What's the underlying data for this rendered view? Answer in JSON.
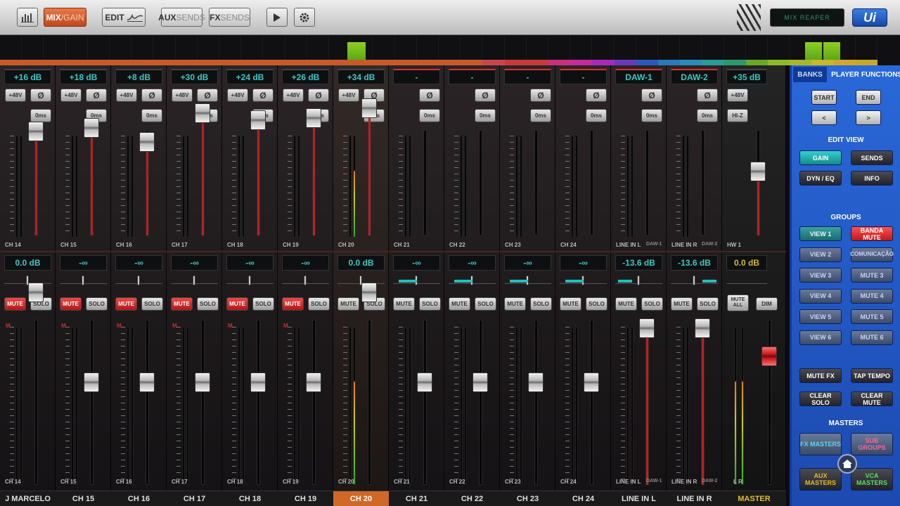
{
  "toolbar": {
    "meters_icon": "meters-icon",
    "mix_label": "MIX",
    "gain_label": "/GAIN",
    "edit_label": "EDIT",
    "aux_label": "AUX",
    "aux_sends_label": "SENDS",
    "fx_label": "FX",
    "fx_sends_label": "SENDS",
    "play_icon": "play-icon",
    "settings_icon": "gear-icon",
    "mix_name": "MIX REAPER",
    "logo": "Ui"
  },
  "overview": {
    "active_color": "#8ed020"
  },
  "common": {
    "phantom": "+48V",
    "phase": "Ø",
    "delay": "0ms",
    "mute": "MUTE",
    "solo": "SOLO",
    "mute_letter": "M",
    "hiz": "HI-Z",
    "mute_all": "MUTE ALL",
    "dim": "DIM"
  },
  "channels": [
    {
      "gain": "+16 dB",
      "upper_label": "CH 14",
      "lower_label": "CH 14",
      "name": "J MARCELO",
      "volume": "0.0 dB",
      "muted": true
    },
    {
      "gain": "+18 dB",
      "upper_label": "CH 15",
      "lower_label": "CH 15",
      "name": "CH 15",
      "volume": "-∞",
      "muted": true
    },
    {
      "gain": "+8 dB",
      "upper_label": "CH 16",
      "lower_label": "CH 16",
      "name": "CH 16",
      "volume": "-∞",
      "muted": true
    },
    {
      "gain": "+30 dB",
      "upper_label": "CH 17",
      "lower_label": "CH 17",
      "name": "CH 17",
      "volume": "-∞",
      "muted": true
    },
    {
      "gain": "+24 dB",
      "upper_label": "CH 18",
      "lower_label": "CH 18",
      "name": "CH 18",
      "volume": "-∞",
      "muted": true
    },
    {
      "gain": "+26 dB",
      "upper_label": "CH 19",
      "lower_label": "CH 19",
      "name": "CH 19",
      "volume": "-∞",
      "muted": true
    },
    {
      "gain": "+34 dB",
      "upper_label": "CH 20",
      "lower_label": "CH 20",
      "name": "CH 20",
      "volume": "0.0 dB",
      "muted": false
    },
    {
      "gain": "-",
      "upper_label": "CH 21",
      "lower_label": "CH 21",
      "name": "CH 21",
      "volume": "-∞",
      "muted": false
    },
    {
      "gain": "-",
      "upper_label": "CH 22",
      "lower_label": "CH 22",
      "name": "CH 22",
      "volume": "-∞",
      "muted": false
    },
    {
      "gain": "-",
      "upper_label": "CH 23",
      "lower_label": "CH 23",
      "name": "CH 23",
      "volume": "-∞",
      "muted": false
    },
    {
      "gain": "-",
      "upper_label": "CH 24",
      "lower_label": "CH 24",
      "name": "CH 24",
      "volume": "-∞",
      "muted": false
    },
    {
      "gain": "DAW-1",
      "upper_label": "LINE IN L",
      "upper_sub": "DAW-1",
      "lower_label": "LINE IN L",
      "lower_sub": "DAW-1",
      "name": "LINE IN L",
      "volume": "-13.6 dB",
      "muted": false
    },
    {
      "gain": "DAW-2",
      "upper_label": "LINE IN R",
      "upper_sub": "DAW-2",
      "lower_label": "LINE IN R",
      "lower_sub": "DAW-2",
      "name": "LINE IN R",
      "volume": "-13.6 dB",
      "muted": false
    }
  ],
  "master": {
    "gain": "+35 dB",
    "upper_label": "HW 1",
    "lower_label": "L  R",
    "name": "MASTER",
    "volume": "0.0 dB"
  },
  "panel": {
    "tabs": [
      "BANKS",
      "PLAYER",
      "FUNCTIONS"
    ],
    "start": "START",
    "end": "END",
    "prev": "<",
    "next": ">",
    "edit_view": "EDIT VIEW",
    "gain": "GAIN",
    "sends": "SENDS",
    "dyn_eq": "DYN / EQ",
    "info": "INFO",
    "groups": "GROUPS",
    "views": [
      "VIEW 1",
      "VIEW 2",
      "VIEW 3",
      "VIEW 4",
      "VIEW 5",
      "VIEW 6"
    ],
    "mute_groups": [
      "BANDA MUTE",
      "COMUNICAÇÃO",
      "MUTE 3",
      "MUTE 4",
      "MUTE 5",
      "MUTE 6"
    ],
    "mute_fx": "MUTE FX",
    "tap_tempo": "TAP TEMPO",
    "clear_solo": "CLEAR SOLO",
    "clear_mute": "CLEAR MUTE",
    "masters": "MASTERS",
    "fx_masters": "FX MASTERS",
    "sub_groups": "SUB GROUPS",
    "aux_masters": "AUX MASTERS",
    "vca_masters": "VCA MASTERS",
    "home_icon": "home-icon"
  }
}
